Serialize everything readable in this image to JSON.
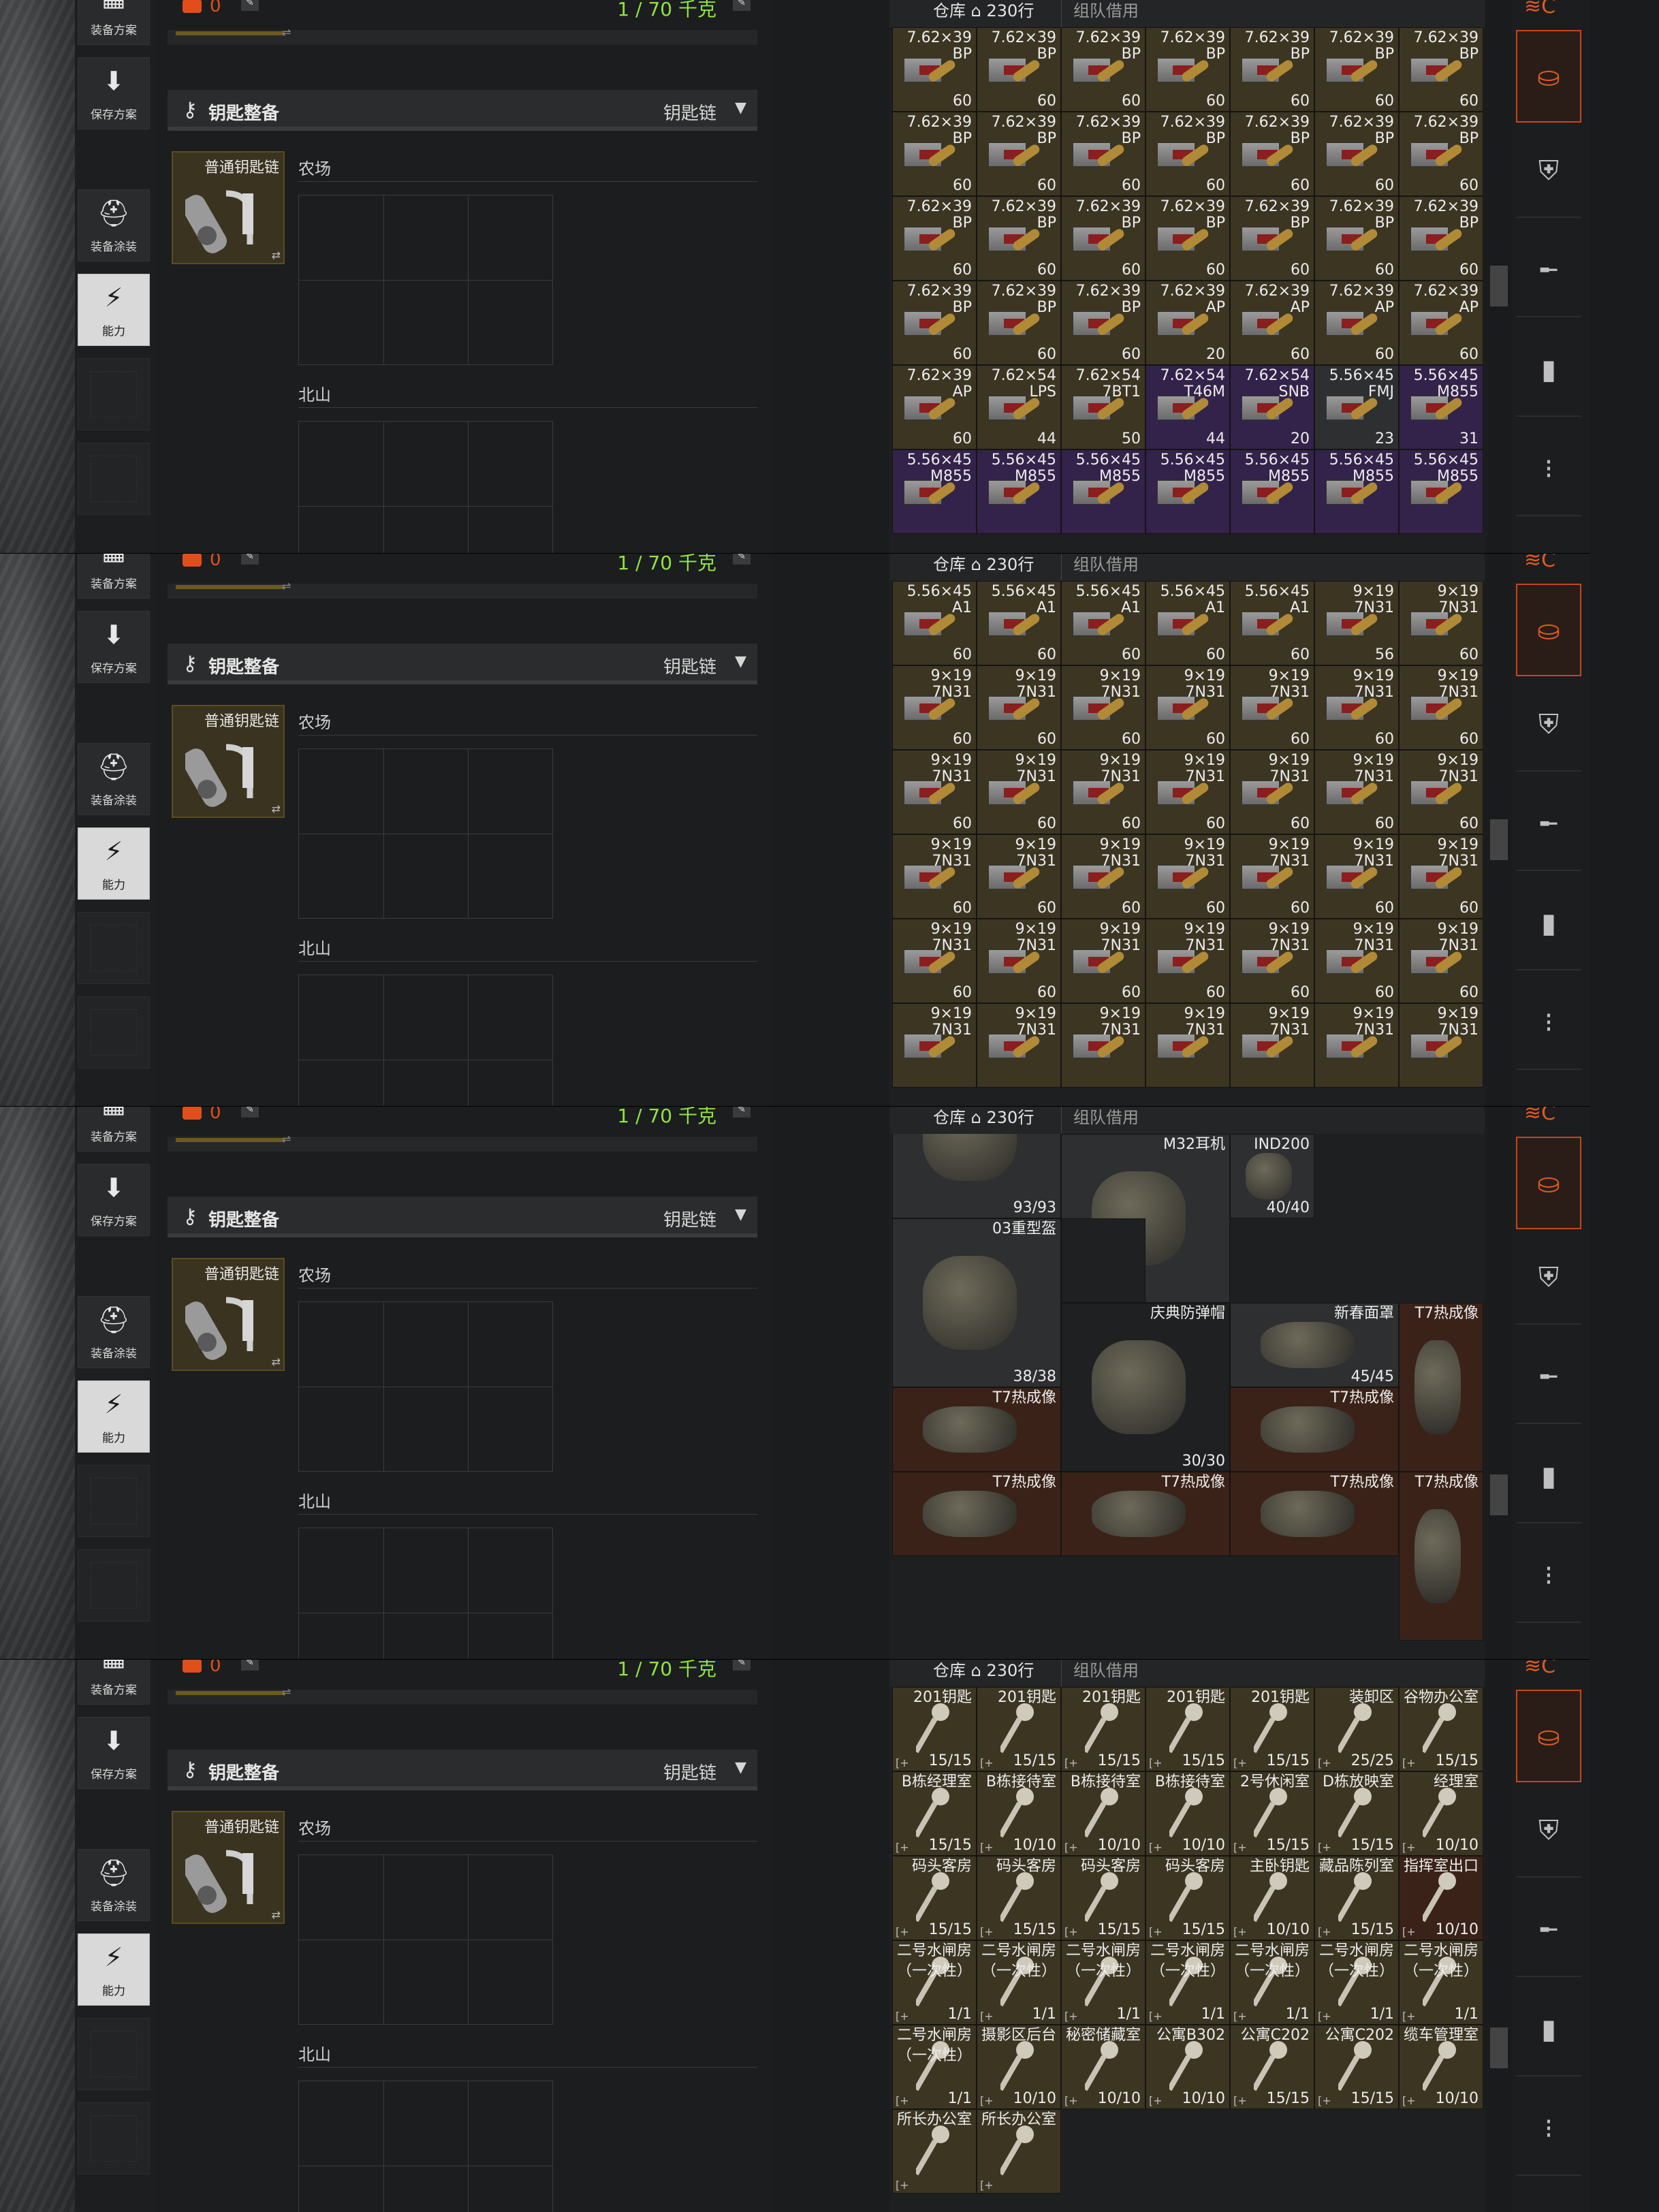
{
  "nav": {
    "equipment_plan": "装备方案",
    "save_plan": "保存方案",
    "equipment_paint": "装备涂装",
    "ability": "能力"
  },
  "top": {
    "currency": "0",
    "weight": "1 / 70 千克"
  },
  "gear_header": {
    "title": "钥匙整备",
    "selector": "钥匙链"
  },
  "keyring": {
    "name": "普通钥匙链"
  },
  "sections": {
    "farm": "农场",
    "north_mountain": "北山"
  },
  "stash": {
    "tab_warehouse": "仓库",
    "rows": "230行",
    "tab_team": "组队借用"
  },
  "panels": [
    {
      "scroll_thumb": "mid",
      "rows": [
        [
          {
            "n": "",
            "n2": "",
            "c": "60",
            "t": "gold"
          },
          {
            "n": "",
            "n2": "",
            "c": "60",
            "t": "gold"
          },
          {
            "n": "",
            "n2": "",
            "c": "60",
            "t": "gold"
          },
          {
            "n": "",
            "n2": "",
            "c": "60",
            "t": "gold"
          },
          {
            "n": "",
            "n2": "",
            "c": "60",
            "t": "gold"
          },
          {
            "n": "",
            "n2": "",
            "c": "60",
            "t": "gold"
          },
          {
            "n": "",
            "n2": "",
            "c": "60",
            "t": "gold"
          }
        ],
        [
          {
            "n": "7.62×39",
            "n2": "BP",
            "c": "60",
            "t": "gold"
          },
          {
            "n": "7.62×39",
            "n2": "BP",
            "c": "60",
            "t": "gold"
          },
          {
            "n": "7.62×39",
            "n2": "BP",
            "c": "60",
            "t": "gold"
          },
          {
            "n": "7.62×39",
            "n2": "BP",
            "c": "60",
            "t": "gold"
          },
          {
            "n": "7.62×39",
            "n2": "BP",
            "c": "60",
            "t": "gold"
          },
          {
            "n": "7.62×39",
            "n2": "BP",
            "c": "60",
            "t": "gold"
          },
          {
            "n": "7.62×39",
            "n2": "BP",
            "c": "60",
            "t": "gold"
          }
        ],
        [
          {
            "n": "7.62×39",
            "n2": "BP",
            "c": "60",
            "t": "gold"
          },
          {
            "n": "7.62×39",
            "n2": "BP",
            "c": "60",
            "t": "gold"
          },
          {
            "n": "7.62×39",
            "n2": "BP",
            "c": "60",
            "t": "gold"
          },
          {
            "n": "7.62×39",
            "n2": "BP",
            "c": "60",
            "t": "gold"
          },
          {
            "n": "7.62×39",
            "n2": "BP",
            "c": "60",
            "t": "gold"
          },
          {
            "n": "7.62×39",
            "n2": "BP",
            "c": "60",
            "t": "gold"
          },
          {
            "n": "7.62×39",
            "n2": "BP",
            "c": "60",
            "t": "gold"
          }
        ],
        [
          {
            "n": "7.62×39",
            "n2": "BP",
            "c": "60",
            "t": "gold"
          },
          {
            "n": "7.62×39",
            "n2": "BP",
            "c": "60",
            "t": "gold"
          },
          {
            "n": "7.62×39",
            "n2": "BP",
            "c": "60",
            "t": "gold"
          },
          {
            "n": "7.62×39",
            "n2": "BP",
            "c": "60",
            "t": "gold"
          },
          {
            "n": "7.62×39",
            "n2": "BP",
            "c": "60",
            "t": "gold"
          },
          {
            "n": "7.62×39",
            "n2": "BP",
            "c": "60",
            "t": "gold"
          },
          {
            "n": "7.62×39",
            "n2": "BP",
            "c": "60",
            "t": "gold"
          }
        ],
        [
          {
            "n": "7.62×39",
            "n2": "BP",
            "c": "60",
            "t": "gold"
          },
          {
            "n": "7.62×39",
            "n2": "BP",
            "c": "60",
            "t": "gold"
          },
          {
            "n": "7.62×39",
            "n2": "BP",
            "c": "60",
            "t": "gold"
          },
          {
            "n": "7.62×39",
            "n2": "AP",
            "c": "20",
            "t": "gold"
          },
          {
            "n": "7.62×39",
            "n2": "AP",
            "c": "60",
            "t": "gold"
          },
          {
            "n": "7.62×39",
            "n2": "AP",
            "c": "60",
            "t": "gold"
          },
          {
            "n": "7.62×39",
            "n2": "AP",
            "c": "60",
            "t": "gold"
          }
        ],
        [
          {
            "n": "7.62×39",
            "n2": "AP",
            "c": "60",
            "t": "gold"
          },
          {
            "n": "7.62×54",
            "n2": "LPS",
            "c": "44",
            "t": "gold"
          },
          {
            "n": "7.62×54",
            "n2": "7BT1",
            "c": "50",
            "t": "gold"
          },
          {
            "n": "7.62×54",
            "n2": "T46M",
            "c": "44",
            "t": "purple"
          },
          {
            "n": "7.62×54",
            "n2": "SNB",
            "c": "20",
            "t": "purple"
          },
          {
            "n": "5.56×45",
            "n2": "FMJ",
            "c": "23",
            "t": "grey"
          },
          {
            "n": "5.56×45",
            "n2": "M855",
            "c": "31",
            "t": "purple"
          }
        ],
        [
          {
            "n": "5.56×45",
            "n2": "M855",
            "c": "",
            "t": "purple"
          },
          {
            "n": "5.56×45",
            "n2": "M855",
            "c": "",
            "t": "purple"
          },
          {
            "n": "5.56×45",
            "n2": "M855",
            "c": "",
            "t": "purple"
          },
          {
            "n": "5.56×45",
            "n2": "M855",
            "c": "",
            "t": "purple"
          },
          {
            "n": "5.56×45",
            "n2": "M855",
            "c": "",
            "t": "purple"
          },
          {
            "n": "5.56×45",
            "n2": "M855",
            "c": "",
            "t": "purple"
          },
          {
            "n": "5.56×45",
            "n2": "M855",
            "c": "",
            "t": "purple"
          }
        ]
      ]
    },
    {
      "scroll_thumb": "mid",
      "rows": [
        [
          {
            "n": "",
            "n2": "A1",
            "c": "60",
            "t": "gold"
          },
          {
            "n": "",
            "n2": "A1",
            "c": "60",
            "t": "gold"
          },
          {
            "n": "",
            "n2": "A1",
            "c": "60",
            "t": "gold"
          },
          {
            "n": "",
            "n2": "A1",
            "c": "60",
            "t": "gold"
          },
          {
            "n": "",
            "n2": "A1",
            "c": "60",
            "t": "gold"
          },
          {
            "n": "",
            "n2": "A1",
            "c": "60",
            "t": "gold"
          },
          {
            "n": "",
            "n2": "A1",
            "c": "60",
            "t": "gold"
          }
        ],
        [
          {
            "n": "5.56×45",
            "n2": "A1",
            "c": "60",
            "t": "gold"
          },
          {
            "n": "5.56×45",
            "n2": "A1",
            "c": "60",
            "t": "gold"
          },
          {
            "n": "5.56×45",
            "n2": "A1",
            "c": "60",
            "t": "gold"
          },
          {
            "n": "5.56×45",
            "n2": "A1",
            "c": "60",
            "t": "gold"
          },
          {
            "n": "5.56×45",
            "n2": "A1",
            "c": "60",
            "t": "gold"
          },
          {
            "n": "9×19",
            "n2": "7N31",
            "c": "56",
            "t": "gold"
          },
          {
            "n": "9×19",
            "n2": "7N31",
            "c": "60",
            "t": "gold"
          }
        ],
        [
          {
            "n": "9×19",
            "n2": "7N31",
            "c": "60",
            "t": "gold"
          },
          {
            "n": "9×19",
            "n2": "7N31",
            "c": "60",
            "t": "gold"
          },
          {
            "n": "9×19",
            "n2": "7N31",
            "c": "60",
            "t": "gold"
          },
          {
            "n": "9×19",
            "n2": "7N31",
            "c": "60",
            "t": "gold"
          },
          {
            "n": "9×19",
            "n2": "7N31",
            "c": "60",
            "t": "gold"
          },
          {
            "n": "9×19",
            "n2": "7N31",
            "c": "60",
            "t": "gold"
          },
          {
            "n": "9×19",
            "n2": "7N31",
            "c": "60",
            "t": "gold"
          }
        ],
        [
          {
            "n": "9×19",
            "n2": "7N31",
            "c": "60",
            "t": "gold"
          },
          {
            "n": "9×19",
            "n2": "7N31",
            "c": "60",
            "t": "gold"
          },
          {
            "n": "9×19",
            "n2": "7N31",
            "c": "60",
            "t": "gold"
          },
          {
            "n": "9×19",
            "n2": "7N31",
            "c": "60",
            "t": "gold"
          },
          {
            "n": "9×19",
            "n2": "7N31",
            "c": "60",
            "t": "gold"
          },
          {
            "n": "9×19",
            "n2": "7N31",
            "c": "60",
            "t": "gold"
          },
          {
            "n": "9×19",
            "n2": "7N31",
            "c": "60",
            "t": "gold"
          }
        ],
        [
          {
            "n": "9×19",
            "n2": "7N31",
            "c": "60",
            "t": "gold"
          },
          {
            "n": "9×19",
            "n2": "7N31",
            "c": "60",
            "t": "gold"
          },
          {
            "n": "9×19",
            "n2": "7N31",
            "c": "60",
            "t": "gold"
          },
          {
            "n": "9×19",
            "n2": "7N31",
            "c": "60",
            "t": "gold"
          },
          {
            "n": "9×19",
            "n2": "7N31",
            "c": "60",
            "t": "gold"
          },
          {
            "n": "9×19",
            "n2": "7N31",
            "c": "60",
            "t": "gold"
          },
          {
            "n": "9×19",
            "n2": "7N31",
            "c": "60",
            "t": "gold"
          }
        ],
        [
          {
            "n": "9×19",
            "n2": "7N31",
            "c": "60",
            "t": "gold"
          },
          {
            "n": "9×19",
            "n2": "7N31",
            "c": "60",
            "t": "gold"
          },
          {
            "n": "9×19",
            "n2": "7N31",
            "c": "60",
            "t": "gold"
          },
          {
            "n": "9×19",
            "n2": "7N31",
            "c": "60",
            "t": "gold"
          },
          {
            "n": "9×19",
            "n2": "7N31",
            "c": "60",
            "t": "gold"
          },
          {
            "n": "9×19",
            "n2": "7N31",
            "c": "60",
            "t": "gold"
          },
          {
            "n": "9×19",
            "n2": "7N31",
            "c": "60",
            "t": "gold"
          }
        ],
        [
          {
            "n": "9×19",
            "n2": "7N31",
            "c": "",
            "t": "gold"
          },
          {
            "n": "9×19",
            "n2": "7N31",
            "c": "",
            "t": "gold"
          },
          {
            "n": "9×19",
            "n2": "7N31",
            "c": "",
            "t": "gold"
          },
          {
            "n": "9×19",
            "n2": "7N31",
            "c": "",
            "t": "gold"
          },
          {
            "n": "9×19",
            "n2": "7N31",
            "c": "",
            "t": "gold"
          },
          {
            "n": "9×19",
            "n2": "7N31",
            "c": "",
            "t": "gold"
          },
          {
            "n": "9×19",
            "n2": "7N31",
            "c": "",
            "t": "gold"
          }
        ]
      ]
    },
    {
      "scroll_thumb": "low",
      "equipment": [
        {
          "name": "",
          "count": "93/93",
          "t": "grey"
        },
        {
          "name": "M32耳机",
          "count": "",
          "t": "grey"
        },
        {
          "name": "IND200",
          "count": "40/40",
          "t": "grey"
        },
        {
          "name": "03重型盔",
          "count": "38/38",
          "t": "grey"
        },
        {
          "name": "庆典防弹帽",
          "count": "30/30",
          "t": "dark"
        },
        {
          "name": "新春面罩",
          "count": "45/45",
          "t": "grey"
        },
        {
          "name": "T7热成像",
          "count": "",
          "t": "red"
        },
        {
          "name": "T7热成像",
          "count": "",
          "t": "red"
        },
        {
          "name": "T7热成像",
          "count": "",
          "t": "red"
        },
        {
          "name": "T7热成像",
          "count": "",
          "t": "red"
        },
        {
          "name": "T7热成像",
          "count": "",
          "t": "red"
        },
        {
          "name": "T7热成像",
          "count": "",
          "t": "red"
        },
        {
          "name": "T7热成像",
          "count": "",
          "t": "red"
        }
      ]
    },
    {
      "scroll_thumb": "low",
      "rows": [
        [
          {
            "n": "",
            "n2": "",
            "c": "15/15",
            "t": "gold"
          },
          {
            "n": "",
            "n2": "",
            "c": "15/15",
            "t": "gold"
          },
          {
            "n": "",
            "n2": "",
            "c": "25/25",
            "t": "purple"
          },
          {
            "n": "",
            "n2": "",
            "c": "25/25",
            "t": "purple"
          },
          {
            "n": "",
            "n2": "",
            "c": "15/15",
            "t": "gold"
          },
          {
            "n": "",
            "n2": "",
            "c": "15/15",
            "t": "gold"
          },
          {
            "n": "",
            "n2": "",
            "c": "15/15",
            "t": "gold"
          }
        ],
        [
          {
            "n": "201钥匙",
            "n2": "",
            "c": "15/15",
            "t": "gold"
          },
          {
            "n": "201钥匙",
            "n2": "",
            "c": "15/15",
            "t": "gold"
          },
          {
            "n": "201钥匙",
            "n2": "",
            "c": "15/15",
            "t": "gold"
          },
          {
            "n": "201钥匙",
            "n2": "",
            "c": "15/15",
            "t": "gold"
          },
          {
            "n": "201钥匙",
            "n2": "",
            "c": "15/15",
            "t": "gold"
          },
          {
            "n": "装卸区",
            "n2": "",
            "c": "25/25",
            "t": "gold"
          },
          {
            "n": "谷物办公室",
            "n2": "",
            "c": "15/15",
            "t": "gold"
          }
        ],
        [
          {
            "n": "B栋经理室",
            "n2": "",
            "c": "15/15",
            "t": "gold"
          },
          {
            "n": "B栋接待室",
            "n2": "",
            "c": "10/10",
            "t": "gold"
          },
          {
            "n": "B栋接待室",
            "n2": "",
            "c": "10/10",
            "t": "gold"
          },
          {
            "n": "B栋接待室",
            "n2": "",
            "c": "10/10",
            "t": "gold"
          },
          {
            "n": "2号休闲室",
            "n2": "",
            "c": "15/15",
            "t": "gold"
          },
          {
            "n": "D栋放映室",
            "n2": "",
            "c": "15/15",
            "t": "gold"
          },
          {
            "n": "经理室",
            "n2": "",
            "c": "10/10",
            "t": "gold"
          }
        ],
        [
          {
            "n": "码头客房",
            "n2": "",
            "c": "15/15",
            "t": "gold"
          },
          {
            "n": "码头客房",
            "n2": "",
            "c": "15/15",
            "t": "gold"
          },
          {
            "n": "码头客房",
            "n2": "",
            "c": "15/15",
            "t": "gold"
          },
          {
            "n": "码头客房",
            "n2": "",
            "c": "15/15",
            "t": "gold"
          },
          {
            "n": "主卧钥匙",
            "n2": "",
            "c": "10/10",
            "t": "gold"
          },
          {
            "n": "藏品陈列室",
            "n2": "",
            "c": "15/15",
            "t": "gold"
          },
          {
            "n": "指挥室出口",
            "n2": "",
            "c": "10/10",
            "t": "red"
          }
        ],
        [
          {
            "n": "二号水闸房",
            "n2": "（一次性）",
            "c": "1/1",
            "t": "gold"
          },
          {
            "n": "二号水闸房",
            "n2": "（一次性）",
            "c": "1/1",
            "t": "gold"
          },
          {
            "n": "二号水闸房",
            "n2": "（一次性）",
            "c": "1/1",
            "t": "gold"
          },
          {
            "n": "二号水闸房",
            "n2": "（一次性）",
            "c": "1/1",
            "t": "gold"
          },
          {
            "n": "二号水闸房",
            "n2": "（一次性）",
            "c": "1/1",
            "t": "gold"
          },
          {
            "n": "二号水闸房",
            "n2": "（一次性）",
            "c": "1/1",
            "t": "gold"
          },
          {
            "n": "二号水闸房",
            "n2": "（一次性）",
            "c": "1/1",
            "t": "gold"
          }
        ],
        [
          {
            "n": "二号水闸房",
            "n2": "（一次性）",
            "c": "1/1",
            "t": "gold"
          },
          {
            "n": "摄影区后台",
            "n2": "",
            "c": "10/10",
            "t": "gold"
          },
          {
            "n": "秘密储藏室",
            "n2": "",
            "c": "10/10",
            "t": "gold"
          },
          {
            "n": "公寓B302",
            "n2": "",
            "c": "10/10",
            "t": "gold"
          },
          {
            "n": "公寓C202",
            "n2": "",
            "c": "15/15",
            "t": "gold"
          },
          {
            "n": "公寓C202",
            "n2": "",
            "c": "15/15",
            "t": "gold"
          },
          {
            "n": "缆车管理室",
            "n2": "",
            "c": "10/10",
            "t": "gold"
          }
        ],
        [
          {
            "n": "所长办公室",
            "n2": "",
            "c": "",
            "t": "gold"
          },
          {
            "n": "所长办公室",
            "n2": "",
            "c": "",
            "t": "gold"
          }
        ]
      ]
    }
  ],
  "icons": {
    "filter": "filter-icon",
    "categories": [
      "key-gear-icon",
      "armor-icon",
      "rifle-icon",
      "magazine-icon",
      "ammo-icon"
    ]
  }
}
